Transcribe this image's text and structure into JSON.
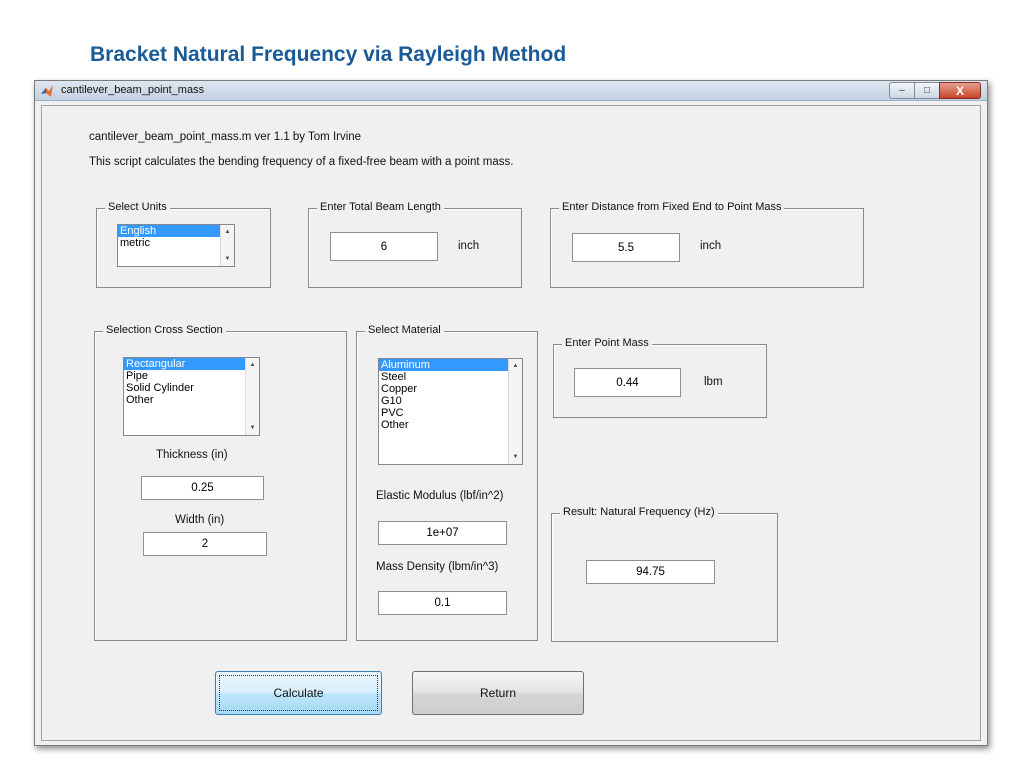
{
  "slide": {
    "title": "Bracket Natural Frequency via Rayleigh Method"
  },
  "window": {
    "title": "cantilever_beam_point_mass",
    "icon": "matlab-icon",
    "controls": {
      "minimize": "–",
      "maximize": "□",
      "close": "X"
    }
  },
  "header": {
    "line1": "cantilever_beam_point_mass.m  ver 1.1  by Tom Irvine",
    "line2": "This script calculates the bending frequency of a fixed-free beam with a point mass."
  },
  "units": {
    "legend": "Select Units",
    "options": [
      "English",
      "metric"
    ],
    "selected": "English"
  },
  "beam_length": {
    "legend": "Enter Total Beam Length",
    "value": "6",
    "unit": "inch"
  },
  "distance": {
    "legend": "Enter Distance from Fixed End to Point Mass",
    "value": "5.5",
    "unit": "inch"
  },
  "cross_section": {
    "legend": "Selection Cross Section",
    "options": [
      "Rectangular",
      "Pipe",
      "Solid Cylinder",
      "Other"
    ],
    "selected": "Rectangular",
    "thickness_label": "Thickness (in)",
    "thickness_value": "0.25",
    "width_label": "Width (in)",
    "width_value": "2"
  },
  "material": {
    "legend": "Select Material",
    "options": [
      "Aluminum",
      "Steel",
      "Copper",
      "G10",
      "PVC",
      "Other"
    ],
    "selected": "Aluminum",
    "modulus_label": "Elastic Modulus (lbf/in^2)",
    "modulus_value": "1e+07",
    "density_label": "Mass Density (lbm/in^3)",
    "density_value": "0.1"
  },
  "point_mass": {
    "legend": "Enter Point Mass",
    "value": "0.44",
    "unit": "lbm"
  },
  "result": {
    "legend": "Result:  Natural Frequency (Hz)",
    "value": "94.75"
  },
  "buttons": {
    "calculate": "Calculate",
    "return": "Return"
  },
  "colors": {
    "title_blue": "#1a5a96",
    "selection": "#3399ff",
    "panel_bg": "#f0f0f0"
  }
}
